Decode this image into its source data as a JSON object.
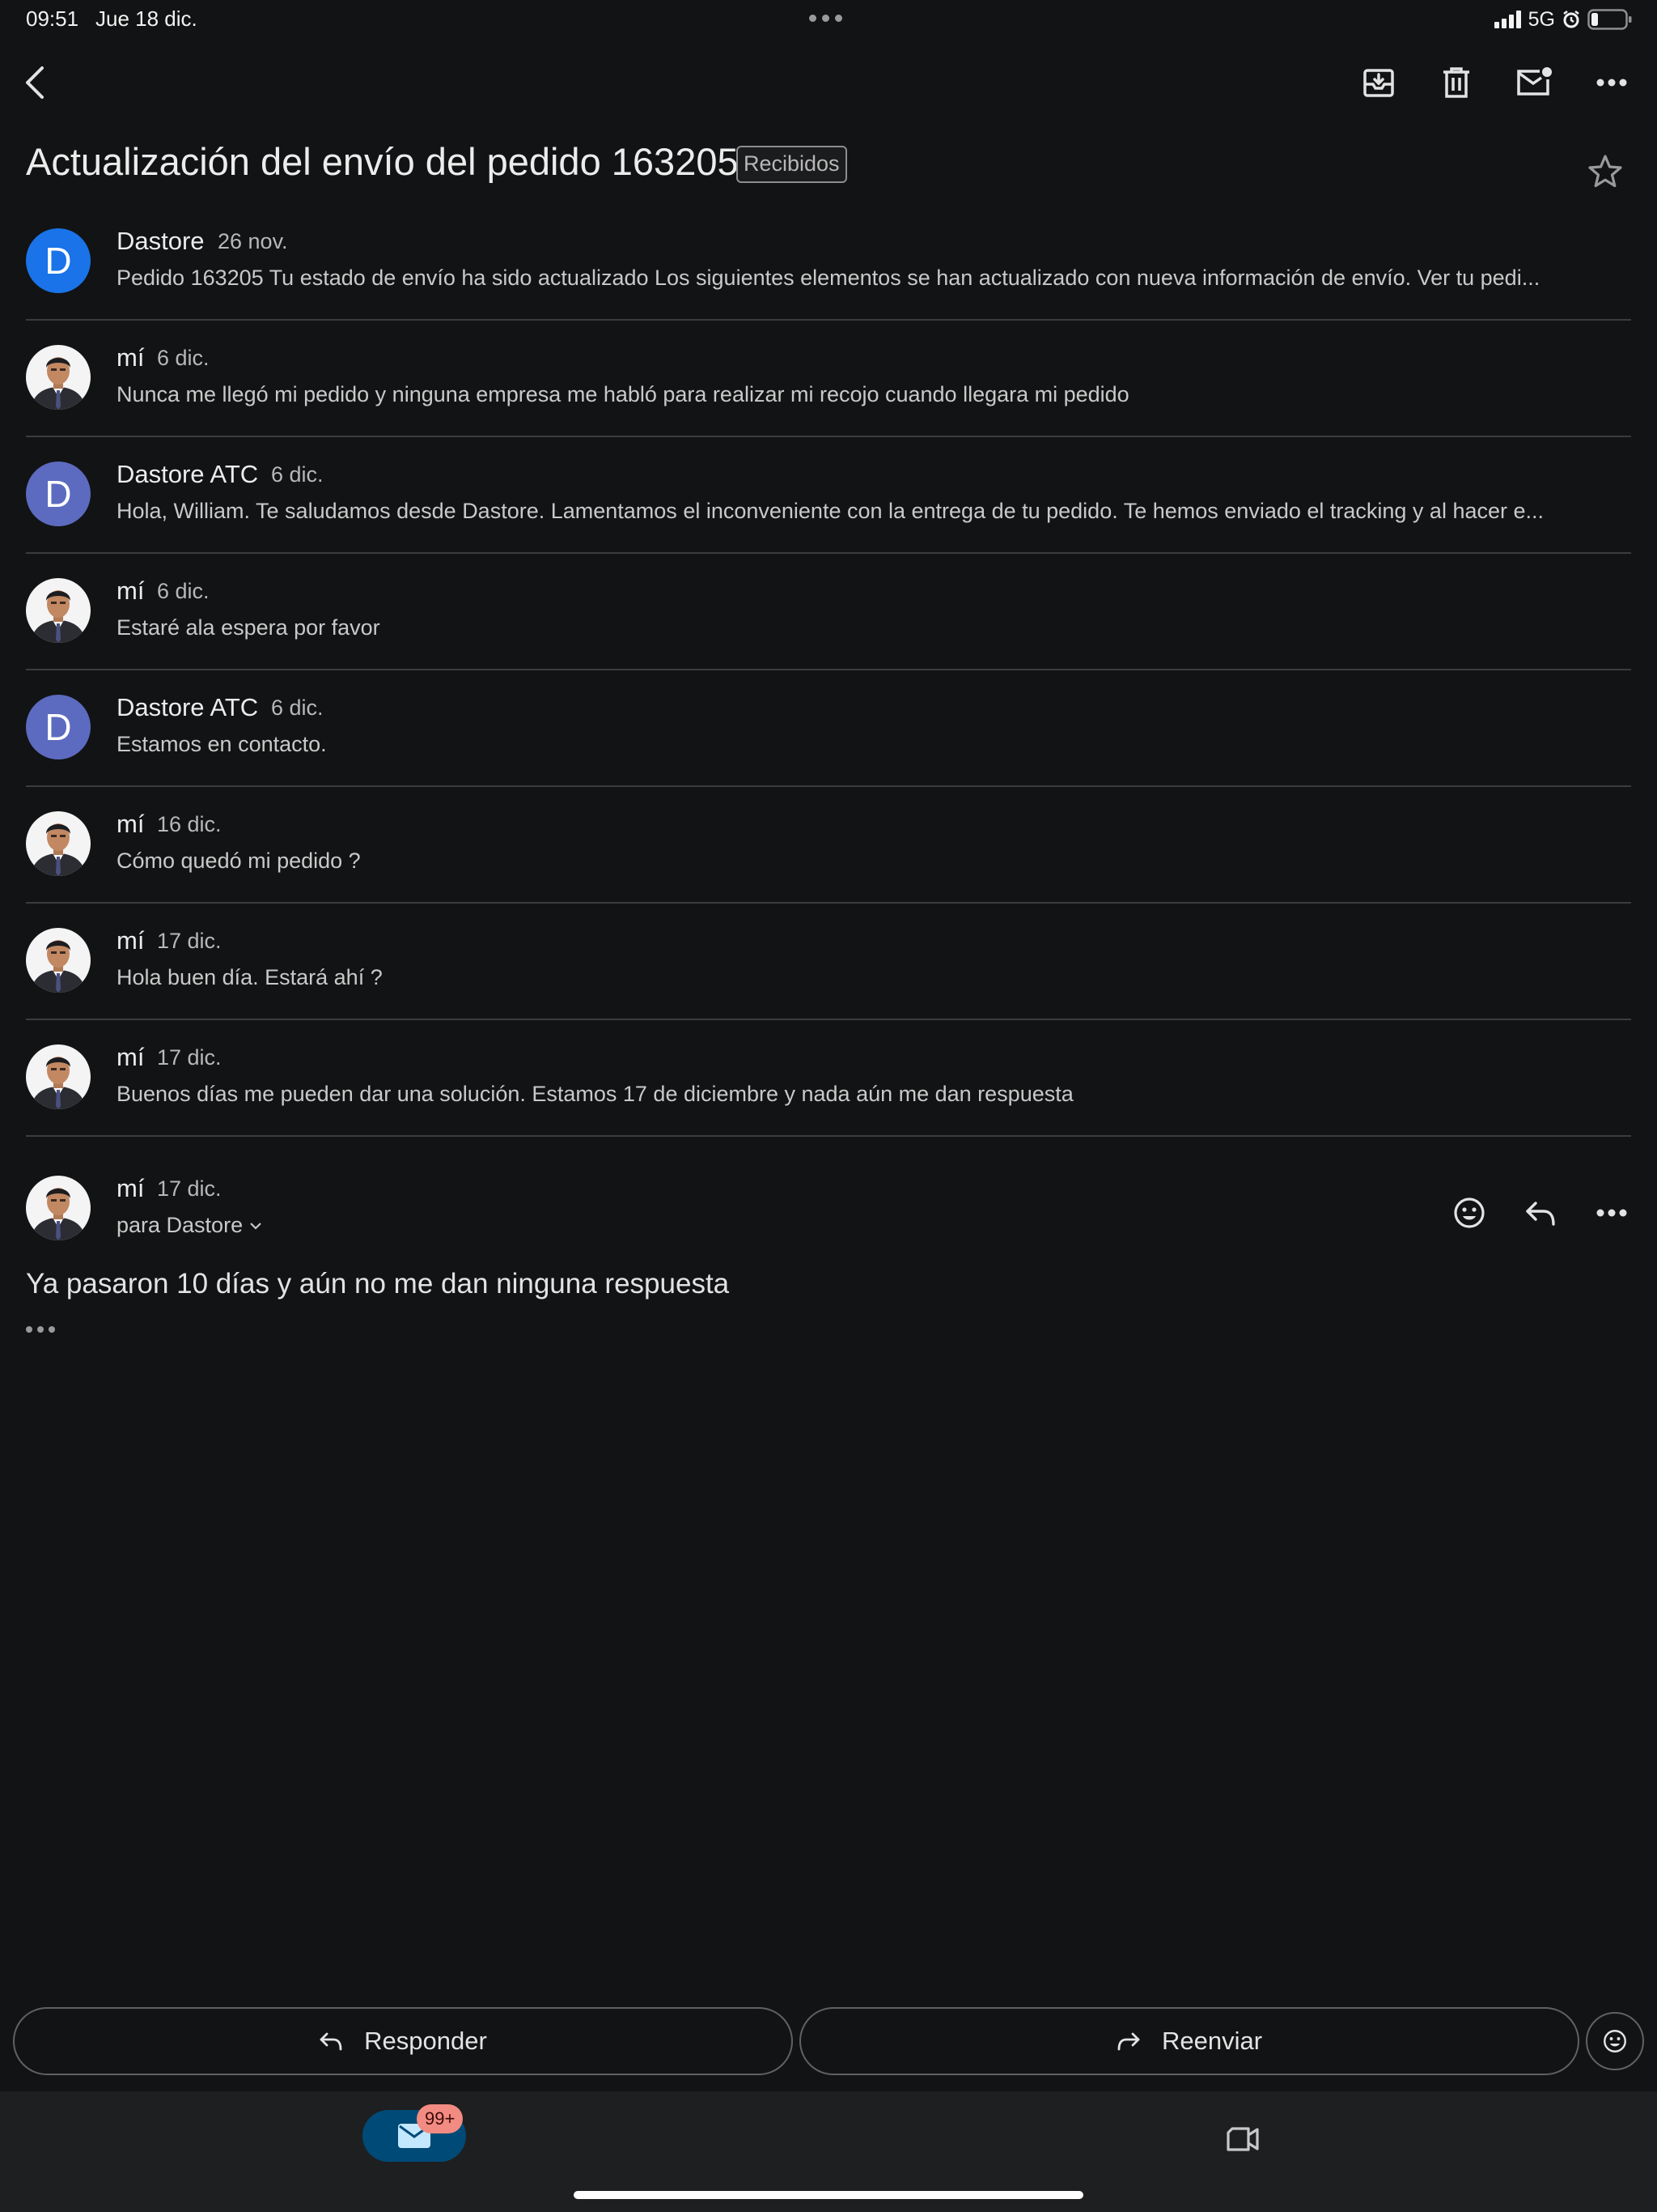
{
  "status_bar": {
    "time": "09:51",
    "date": "Jue 18 dic.",
    "network": "5G"
  },
  "toolbar": {
    "back_icon": "chevron-left-icon",
    "archive_icon": "archive-icon",
    "delete_icon": "trash-icon",
    "unread_icon": "mark-unread-icon",
    "more_icon": "more-horizontal-icon"
  },
  "thread": {
    "subject": "Actualización del envío del pedido 163205",
    "label": "Recibidos"
  },
  "messages": [
    {
      "sender": "Dastore",
      "date": "26 nov.",
      "snippet": "Pedido 163205 Tu estado de envío ha sido actualizado Los siguientes elementos se han actualizado con nueva información de envío. Ver tu pedi...",
      "avatar": "D",
      "avatar_color": "#1a73e8"
    },
    {
      "sender": "mí",
      "date": "6 dic.",
      "snippet": "Nunca me llegó mi pedido y ninguna empresa me habló para realizar mi recojo cuando llegara mi pedido",
      "avatar": "photo"
    },
    {
      "sender": "Dastore ATC",
      "date": "6 dic.",
      "snippet": "Hola, William. Te saludamos desde Dastore. Lamentamos el inconveniente con la entrega de tu pedido. Te hemos enviado el tracking y al hacer e...",
      "avatar": "D",
      "avatar_color": "#5c6bc0"
    },
    {
      "sender": "mí",
      "date": "6 dic.",
      "snippet": "Estaré ala espera por favor",
      "avatar": "photo"
    },
    {
      "sender": "Dastore ATC",
      "date": "6 dic.",
      "snippet": "Estamos en contacto.",
      "avatar": "D",
      "avatar_color": "#5c6bc0"
    },
    {
      "sender": "mí",
      "date": "16 dic.",
      "snippet": "Cómo quedó mi pedido ?",
      "avatar": "photo"
    },
    {
      "sender": "mí",
      "date": "17 dic.",
      "snippet": "Hola buen día. Estará ahí ?",
      "avatar": "photo"
    },
    {
      "sender": "mí",
      "date": "17 dic.",
      "snippet": "Buenos días me pueden dar una solución. Estamos 17 de diciembre y nada aún me dan respuesta",
      "avatar": "photo"
    }
  ],
  "expanded": {
    "sender": "mí",
    "date": "17 dic.",
    "to": "para Dastore",
    "body": "Ya pasaron 10 días y aún no me dan ninguna respuesta"
  },
  "actions": {
    "reply": "Responder",
    "forward": "Reenviar"
  },
  "nav": {
    "mail_badge": "99+"
  }
}
